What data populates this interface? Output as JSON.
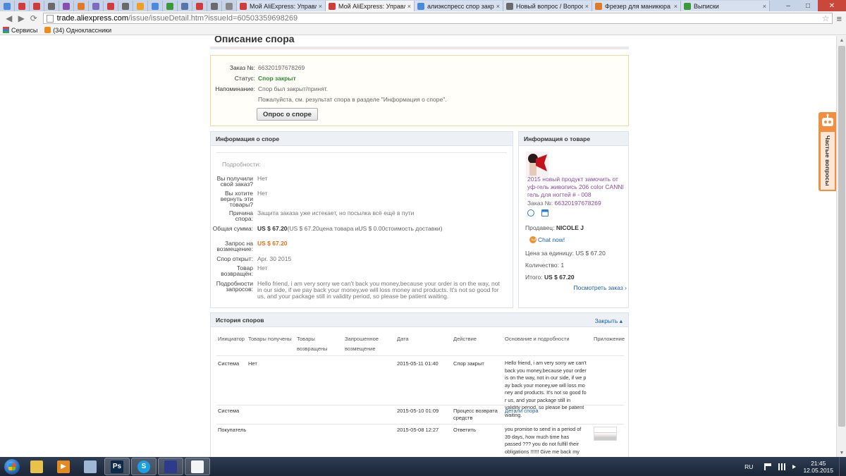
{
  "browser": {
    "pinned_tab_colors": [
      "#4b89dc",
      "#d13b3b",
      "#d13b3b",
      "#6a6a6a",
      "#8b4caf",
      "#e07a2b",
      "#7b6cbf",
      "#d13b3b",
      "#6a6a6a",
      "#f0a020",
      "#4b89dc",
      "#3a9a3a",
      "#5577aa",
      "#d13b3b",
      "#6a6a6a",
      "#888888"
    ],
    "tabs": [
      {
        "title": "Мой AliExpress: Управлени",
        "color": "#d13b3b",
        "active": false
      },
      {
        "title": "Мой AliExpress: Управлени",
        "color": "#d13b3b",
        "active": true
      },
      {
        "title": "алиэкспресс спор закрыт",
        "color": "#4b89dc",
        "active": false
      },
      {
        "title": "Новый вопрос / Вопросы",
        "color": "#6a6a6a",
        "active": false
      },
      {
        "title": "Фрезер для маникюра M",
        "color": "#e07a2b",
        "active": false
      },
      {
        "title": "Выписки",
        "color": "#3a9a3a",
        "active": false
      }
    ],
    "tab_close": "×",
    "window": {
      "minimize": "–",
      "maximize": "□",
      "close": "✕"
    },
    "url_host": "trade.aliexpress.com",
    "url_path": "/issue/issueDetail.htm?issueId=60503359698269",
    "bookmarks": [
      {
        "label": "Сервисы",
        "icon_color": "#e0462e"
      },
      {
        "label": "(34) Одноклассники",
        "icon_color": "#f08a1c"
      }
    ]
  },
  "page": {
    "heading": "Описание спора",
    "summary": {
      "order_label": "Заказ №:",
      "order_value": "66320197678269",
      "status_label": "Статус:",
      "status_value": "Спор закрыт",
      "reminder_label": "Напоминание:",
      "reminder_line1": "Спор был закрыт/принят.",
      "reminder_line2": "Пожалуйста, см. результат спора в разделе \"Информация о споре\".",
      "survey_button": "Опрос о споре"
    },
    "dispute": {
      "title": "Информация о споре",
      "details_label": "Подробности:",
      "rows": [
        {
          "label": "Вы получили свой заказ?",
          "value": "Нет"
        },
        {
          "label": "Вы хотите вернуть эти товары?",
          "value": "Нет"
        },
        {
          "label": "Причина спора:",
          "value": "Защита заказа уже истекает, но посылка всё ещё в пути"
        },
        {
          "label": "Общая сумма:",
          "value_bold": "US $ 67.20",
          "value_rest": "(US $ 67.20цена товара иUS $ 0.00стоимость доставки)"
        },
        {
          "label": "Запрос на возмещение:",
          "value": "US $ 67.20"
        },
        {
          "label": "Спор открыт:",
          "value": "Apr. 30 2015"
        },
        {
          "label": "Товар возвращён:",
          "value": "Нет"
        },
        {
          "label": "Подробности запросов:",
          "value": "Hello friend, i am very sorry we can't back you money,because your order is on the way, not in our side, if we pay back your money,we will loss money and products. It's not so good for us, and your package still in validity period, so please be patient waiting."
        }
      ]
    },
    "product": {
      "title": "Информация о товаре",
      "name": "2015 новый продукт замочить от уф-гель живопись 206 color CANNI гель для ногтей # - 008",
      "order_label": "Заказ №:",
      "order_value": "66320197678269",
      "seller_label": "Продавец:",
      "seller_value": "NICOLE J",
      "chat_label": "Chat now!",
      "price_label": "Цена за единицу:",
      "price_value": "US $ 67.20",
      "qty_label": "Количество:",
      "qty_value": "1",
      "total_label": "Итого:",
      "total_value": "US $ 67.20",
      "view_order": "Посмотреть заказ ›"
    },
    "history": {
      "title": "История споров",
      "toggle": "Закрыть ▴",
      "columns": [
        "Инициатор",
        "Товары получены",
        "Товары возвращены",
        "Запрошенное возмещение",
        "Дата",
        "Действие",
        "Основание и подробности",
        "Приложение"
      ],
      "rows": [
        {
          "initiator": "Система",
          "received": "Нет",
          "date": "2015-05-11 01:40",
          "action": "Спор закрыт",
          "reason": "Hello friend, i am very sorry we can't back you money,because your order is on the way, not in our side, if we p ay back your money,we will loss mo ney and products. It's not so good fo r us, and your package still in validity period, so please be patient waiting."
        },
        {
          "initiator": "Система",
          "received": "",
          "date": "2015-05-10 01:09",
          "action": "Процесс возврата средств",
          "reason": "Детали спора"
        },
        {
          "initiator": "Покупатель",
          "received": "",
          "date": "2015-05-08 12:27",
          "action": "Ответить",
          "reason": "you promise to send in a period of 39 days, how much time has passed ??? you do not fulfill their obligations !!!!!! Give me back my money !!!"
        }
      ]
    },
    "faq_widget": "Частые вопросы"
  },
  "taskbar": {
    "apps": [
      {
        "name": "explorer",
        "label": "",
        "color": "#e9c24a"
      },
      {
        "name": "media-player",
        "label": "▶",
        "color": "#e58a1f"
      },
      {
        "name": "calculator",
        "label": "",
        "color": "#9fb6d6"
      },
      {
        "name": "photoshop",
        "label": "Ps",
        "color": "#0e2a4a"
      },
      {
        "name": "skype",
        "label": "S",
        "color": "#1a9fe0"
      },
      {
        "name": "save",
        "label": "",
        "color": "#2e3b8a"
      },
      {
        "name": "notepad",
        "label": "",
        "color": "#f4f4f4"
      }
    ],
    "lang": "RU",
    "time": "21:45",
    "date": "12.05.2015"
  }
}
